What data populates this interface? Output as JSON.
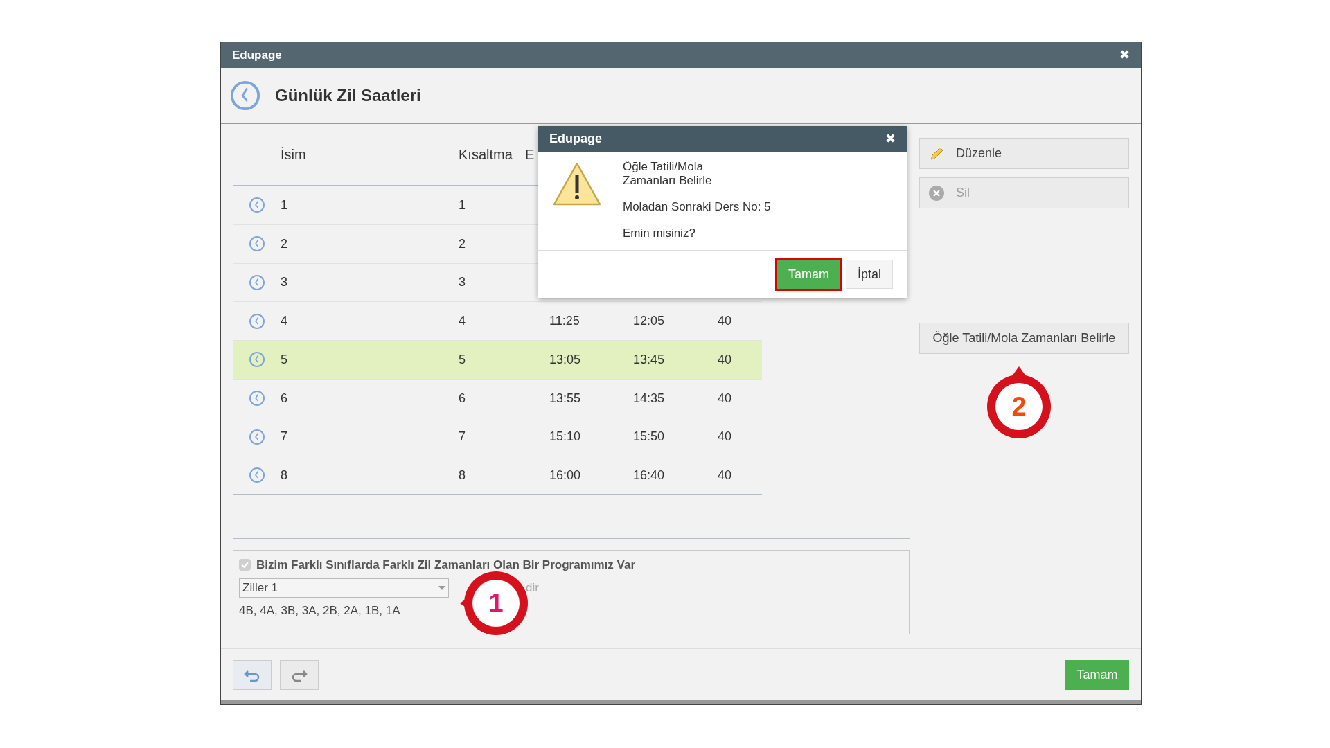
{
  "window": {
    "title": "Edupage",
    "close": "✖"
  },
  "header": {
    "title": "Günlük Zil Saatleri"
  },
  "table": {
    "columns": [
      "İsim",
      "Kısaltma",
      "E"
    ],
    "rows": [
      {
        "name": "1",
        "short": "1",
        "selected": false
      },
      {
        "name": "2",
        "short": "2",
        "selected": false
      },
      {
        "name": "3",
        "short": "3",
        "selected": false
      },
      {
        "name": "4",
        "short": "4",
        "start": "11:25",
        "end": "12:05",
        "length": "40",
        "selected": false
      },
      {
        "name": "5",
        "short": "5",
        "start": "13:05",
        "end": "13:45",
        "length": "40",
        "selected": true
      },
      {
        "name": "6",
        "short": "6",
        "start": "13:55",
        "end": "14:35",
        "length": "40",
        "selected": false
      },
      {
        "name": "7",
        "short": "7",
        "start": "15:10",
        "end": "15:50",
        "length": "40",
        "selected": false
      },
      {
        "name": "8",
        "short": "8",
        "start": "16:00",
        "end": "16:40",
        "length": "40",
        "selected": false
      }
    ]
  },
  "side_buttons": [
    {
      "kind": "edit",
      "label": "Düzenle",
      "disabled": false
    },
    {
      "kind": "delete",
      "label": "Sil",
      "disabled": true
    },
    {
      "kind": "plain",
      "label": "Öğle Tatili/Mola Zamanları Belirle",
      "disabled": false
    }
  ],
  "bell_groups": {
    "checkbox": {
      "label": "Bizim Farklı Sınıflarda Farklı Zil Zamanları Olan Bir Programımız Var",
      "checked": true,
      "disabled": true
    },
    "select": {
      "value": "Ziller 1"
    },
    "partial_text": "dir",
    "classes": "4B, 4A, 3B, 3A, 2B, 2A, 1B, 1A"
  },
  "footer": {
    "ok": "Tamam"
  },
  "dialog": {
    "title": "Edupage",
    "close": "✖",
    "lines": [
      "Öğle Tatili/Mola\nZamanları Belirle",
      "Moladan Sonraki Ders No: 5",
      "Emin misiniz?"
    ],
    "buttons": [
      {
        "label": "Tamam",
        "primary": true,
        "highlighted": true
      },
      {
        "label": "İptal",
        "primary": false,
        "highlighted": false
      }
    ]
  },
  "callouts": [
    {
      "label": "1"
    },
    {
      "label": "2"
    }
  ]
}
